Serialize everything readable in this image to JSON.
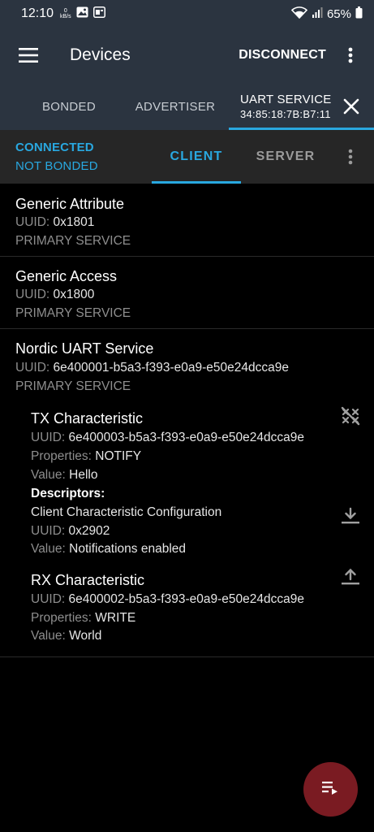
{
  "status_bar": {
    "time": "12:10",
    "data_rate_top": "0",
    "data_rate_unit": "kB/s",
    "battery": "65%"
  },
  "toolbar": {
    "title": "Devices",
    "disconnect_label": "DISCONNECT"
  },
  "tabs": {
    "bonded": "BONDED",
    "advertiser": "ADVERTISER",
    "uart_title": "UART SERVICE",
    "uart_address": "34:85:18:7B:B7:11"
  },
  "subheader": {
    "connection_state": "CONNECTED",
    "bond_state": "NOT BONDED",
    "client_tab": "CLIENT",
    "server_tab": "SERVER"
  },
  "labels": {
    "uuid": "UUID:",
    "properties": "Properties:",
    "value": "Value:",
    "descriptors": "Descriptors:"
  },
  "services": [
    {
      "name": "Generic Attribute",
      "uuid": "0x1801",
      "type": "PRIMARY SERVICE"
    },
    {
      "name": "Generic Access",
      "uuid": "0x1800",
      "type": "PRIMARY SERVICE"
    },
    {
      "name": "Nordic UART Service",
      "uuid": "6e400001-b5a3-f393-e0a9-e50e24dcca9e",
      "type": "PRIMARY SERVICE",
      "characteristics": [
        {
          "name": "TX Characteristic",
          "uuid": "6e400003-b5a3-f393-e0a9-e50e24dcca9e",
          "properties": "NOTIFY",
          "value": "Hello",
          "descriptor": {
            "name": "Client Characteristic Configuration",
            "uuid": "0x2902",
            "value": "Notifications enabled"
          }
        },
        {
          "name": "RX Characteristic",
          "uuid": "6e400002-b5a3-f393-e0a9-e50e24dcca9e",
          "properties": "WRITE",
          "value": "World"
        }
      ]
    }
  ],
  "icons": {
    "menu": "hamburger-menu-icon",
    "overflow": "more-vert-icon",
    "close": "close-icon",
    "notify_toggle": "notifications-off-icon",
    "read": "download-icon",
    "write": "upload-icon",
    "fab": "playlist-play-icon"
  },
  "colors": {
    "accent": "#29a8e0",
    "toolbar": "#2b3440",
    "fab": "#7a1b22"
  }
}
